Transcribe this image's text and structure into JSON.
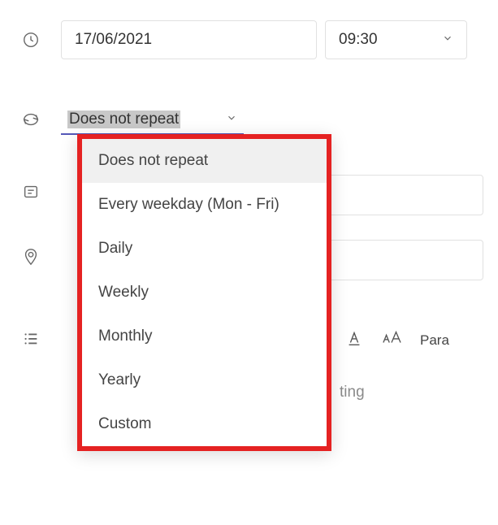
{
  "datetime": {
    "date": "17/06/2021",
    "time": "09:30"
  },
  "repeat": {
    "selected": "Does not repeat",
    "options": [
      "Does not repeat",
      "Every weekday (Mon - Fri)",
      "Daily",
      "Weekly",
      "Monthly",
      "Yearly",
      "Custom"
    ]
  },
  "behind": {
    "meeting_fragment": "ting"
  },
  "toolbar": {
    "paragraph_label": "Para"
  }
}
